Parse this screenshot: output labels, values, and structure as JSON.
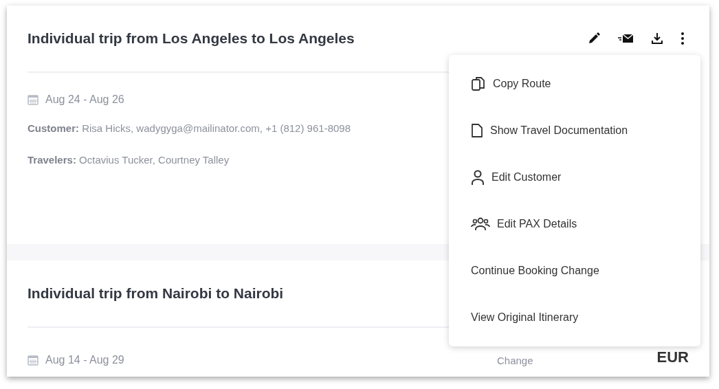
{
  "trips": [
    {
      "title": "Individual trip from Los Angeles to Los Angeles",
      "dates": "Aug 24 - Aug 26",
      "customer_label": "Customer:",
      "customer": "Risa Hicks, wadygyga@mailinator.com, +1 (812) 961-8098",
      "travelers_label": "Travelers:",
      "travelers": "Octavius Tucker, Courtney Talley"
    },
    {
      "title": "Individual trip from Nairobi to Nairobi",
      "dates": "Aug 14 - Aug 29",
      "status": "Change",
      "currency": "EUR"
    }
  ],
  "menu": {
    "items": [
      {
        "label": "Copy Route",
        "kind": "copy"
      },
      {
        "label": "Show Travel Documentation",
        "kind": "document"
      },
      {
        "label": "Edit Customer",
        "kind": "person"
      },
      {
        "label": "Edit PAX Details",
        "kind": "group"
      },
      {
        "label": "Continue Booking Change",
        "kind": "plain"
      },
      {
        "label": "View Original Itinerary",
        "kind": "plain"
      }
    ]
  }
}
